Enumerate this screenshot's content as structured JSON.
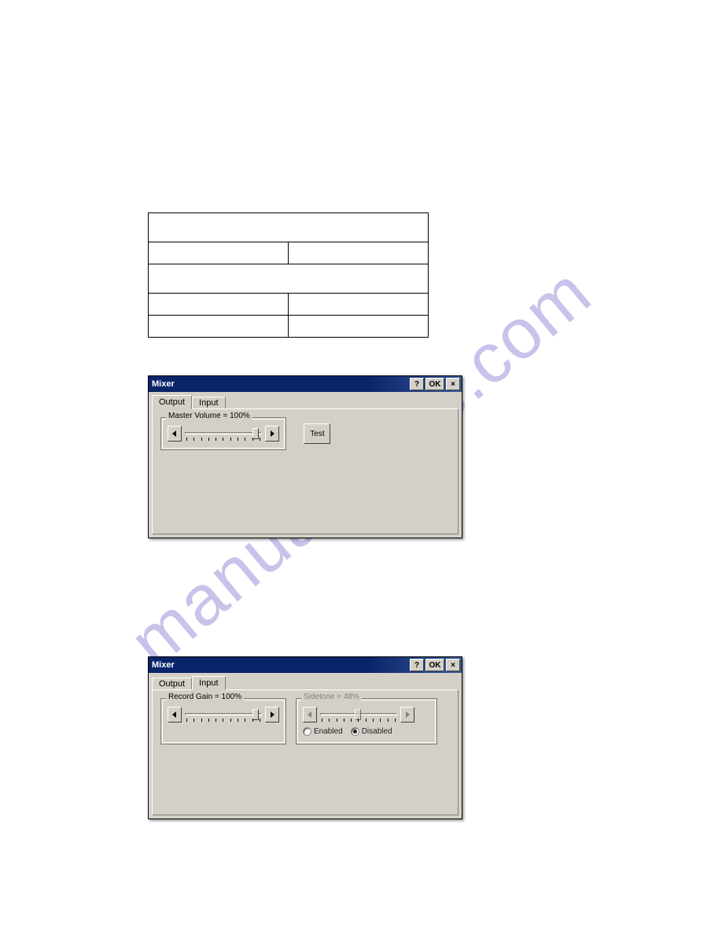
{
  "watermark": "manualshive.com",
  "dialog1": {
    "title": "Mixer",
    "help": "?",
    "ok": "OK",
    "close": "×",
    "tabs": {
      "output": "Output",
      "input": "Input"
    },
    "group_label": "Master Volume = 100%",
    "test_label": "Test"
  },
  "dialog2": {
    "title": "Mixer",
    "help": "?",
    "ok": "OK",
    "close": "×",
    "tabs": {
      "output": "Output",
      "input": "Input"
    },
    "record_label": "Record Gain = 100%",
    "sidetone_label": "Sidetone = 48%",
    "radio_enabled": "Enabled",
    "radio_disabled": "Disabled"
  }
}
